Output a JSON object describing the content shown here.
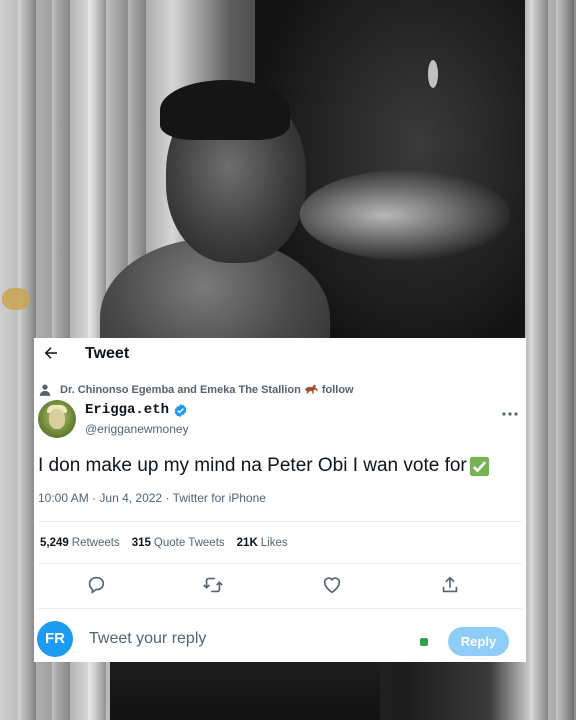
{
  "header": {
    "title": "Tweet"
  },
  "social_context": {
    "text_before": "Dr. Chinonso Egemba and Emeka The Stallion",
    "text_after": "follow"
  },
  "author": {
    "name": "Erigga.eth",
    "handle": "@erigganewmoney",
    "verified": true
  },
  "tweet": {
    "text": "I don make up my mind na Peter Obi I wan vote for",
    "time": "10:00 AM",
    "date": "Jun 4, 2022",
    "source": "Twitter for iPhone",
    "separator": "·"
  },
  "stats": [
    {
      "count": "5,249",
      "label": "Retweets"
    },
    {
      "count": "315",
      "label": "Quote Tweets"
    },
    {
      "count": "21K",
      "label": "Likes"
    }
  ],
  "actions": [
    "reply-icon",
    "retweet-icon",
    "like-icon",
    "share-icon"
  ],
  "reply": {
    "avatar_text": "FR",
    "placeholder": "Tweet your reply",
    "button_label": "Reply"
  },
  "colors": {
    "accent": "#1d9bf0",
    "reply_button": "#8ecdf8",
    "check_green": "#77b255",
    "secondary_text": "#536471"
  },
  "icons": {
    "back": "back-arrow-icon",
    "social": "person-icon",
    "horse": "horse-icon",
    "verified": "verified-badge-icon",
    "more": "more-icon",
    "check": "check-mark-emoji-icon"
  }
}
